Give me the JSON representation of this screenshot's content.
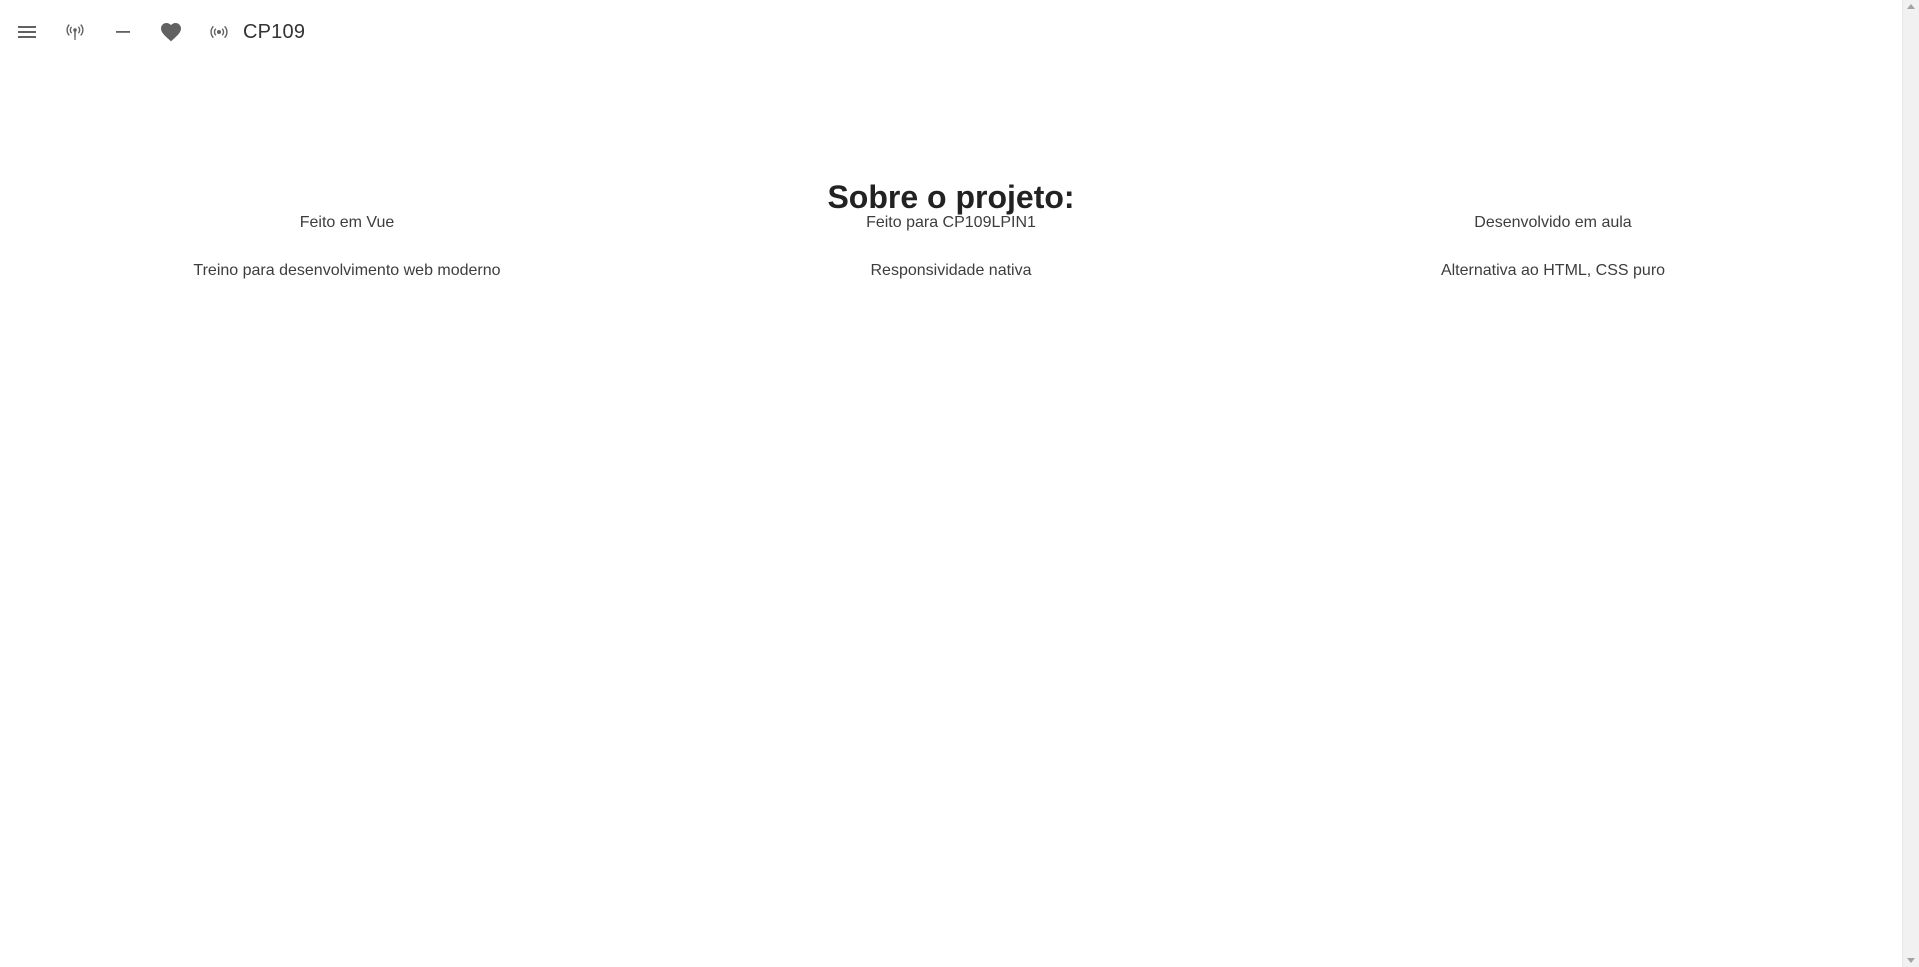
{
  "app": {
    "title": "CP109"
  },
  "toolbar": {
    "icons": [
      {
        "name": "menu-icon"
      },
      {
        "name": "antenna-icon"
      },
      {
        "name": "minus-icon"
      },
      {
        "name": "heart-icon"
      },
      {
        "name": "broadcast-icon"
      }
    ],
    "icon_color": "#616161"
  },
  "main": {
    "heading": "Sobre o projeto:",
    "rows": [
      [
        "Feito em Vue",
        "Feito para CP109LPIN1",
        "Desenvolvido em aula"
      ],
      [
        "Treino para desenvolvimento web moderno",
        "Responsividade nativa",
        "Alternativa ao HTML, CSS puro"
      ]
    ]
  }
}
